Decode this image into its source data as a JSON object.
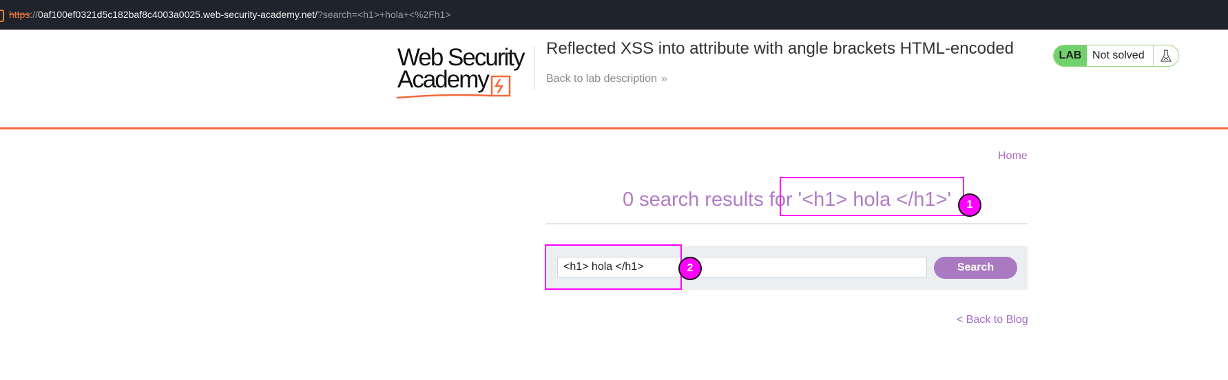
{
  "browser": {
    "url_scheme": "https",
    "url_sep": "://",
    "url_host": "0af100ef0321d5c182baf8c4003a0025.web-security-academy.net/",
    "url_query": "?search=<h1>+hola+<%2Fh1>"
  },
  "lab_header": {
    "logo_line1": "Web Security",
    "logo_line2": "Academy",
    "title": "Reflected XSS into attribute with angle brackets HTML-encoded",
    "back_link": "Back to lab description",
    "back_link_chevron": "»",
    "lab_badge": "LAB",
    "status": "Not solved",
    "accent_color": "#f26a37",
    "status_color": "#70d16d"
  },
  "nav": {
    "home": "Home"
  },
  "results": {
    "heading": "0 search results for '<h1> hola </h1>'"
  },
  "search": {
    "value": "<h1> hola </h1>",
    "button": "Search"
  },
  "footer": {
    "back_to_blog": "< Back to Blog"
  },
  "annotations": [
    {
      "label": "1"
    },
    {
      "label": "2"
    }
  ],
  "icons": {
    "flask": "flask-icon",
    "lock": "lock-icon"
  }
}
